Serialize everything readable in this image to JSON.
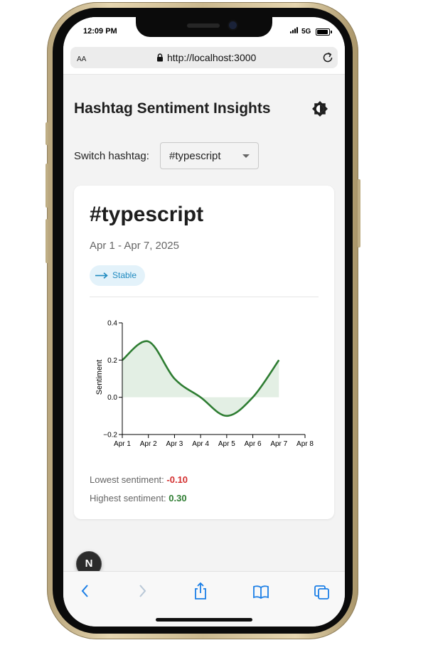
{
  "status_bar": {
    "time": "12:09 PM",
    "network": "5G"
  },
  "browser": {
    "text_size_label": "AA",
    "url": "http://localhost:3000",
    "toolbar_icons": [
      "back-icon",
      "forward-icon",
      "share-icon",
      "bookmarks-icon",
      "tabs-icon"
    ]
  },
  "page": {
    "title": "Hashtag Sentiment Insights",
    "switch_label": "Switch hashtag:",
    "selected_hashtag": "#typescript"
  },
  "card": {
    "hashtag": "#typescript",
    "date_range": "Apr 1 - Apr 7, 2025",
    "trend_label": "Stable",
    "lowest_label": "Lowest sentiment:",
    "lowest_value": "-0.10",
    "highest_label": "Highest sentiment:",
    "highest_value": "0.30"
  },
  "colors": {
    "line": "#2e7d32",
    "area": "#e3efe4",
    "low": "#d32f2f",
    "high": "#2e7d32",
    "chip_bg": "#e3f2fa",
    "chip_text": "#1f8ac0"
  },
  "chart_data": {
    "type": "area",
    "x": [
      "Apr 1",
      "Apr 2",
      "Apr 3",
      "Apr 4",
      "Apr 5",
      "Apr 6",
      "Apr 7"
    ],
    "x_ticks": [
      "Apr 1",
      "Apr 2",
      "Apr 3",
      "Apr 4",
      "Apr 5",
      "Apr 6",
      "Apr 7",
      "Apr 8"
    ],
    "series": [
      {
        "values": [
          0.2,
          0.3,
          0.1,
          0.0,
          -0.1,
          0.0,
          0.2
        ]
      }
    ],
    "ylabel": "Sentiment",
    "xlabel": "",
    "ylim": [
      -0.2,
      0.4
    ],
    "y_ticks": [
      -0.2,
      0.0,
      0.2,
      0.4
    ],
    "y_tick_labels": [
      "−0.2",
      "0.0",
      "0.2",
      "0.4"
    ],
    "grid": false
  },
  "dev_badge": {
    "label": "N"
  }
}
